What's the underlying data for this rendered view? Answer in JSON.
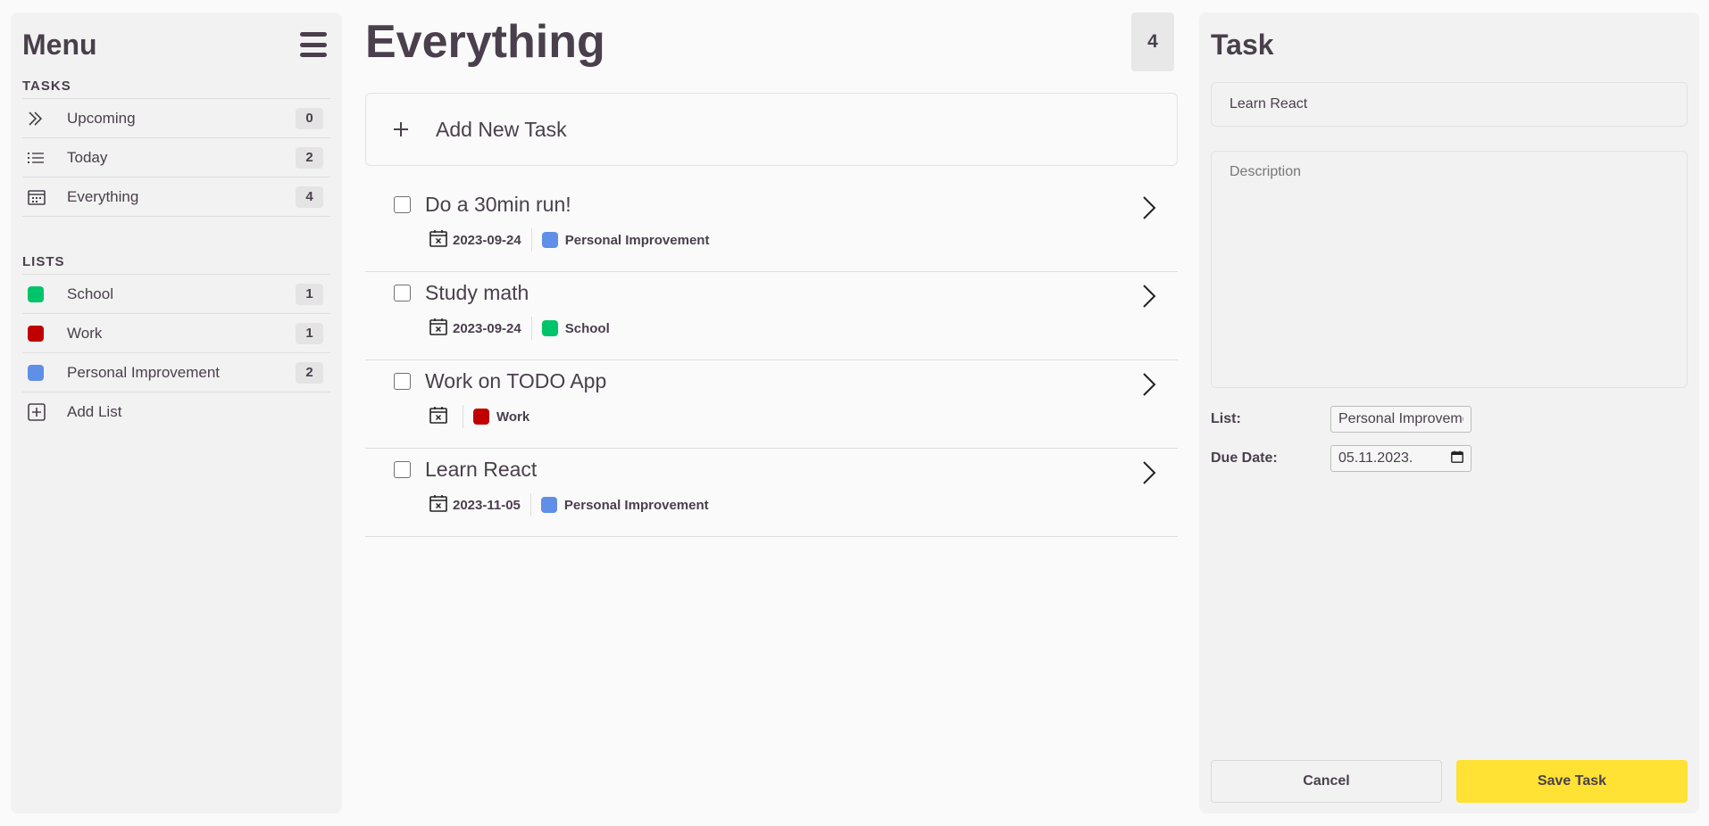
{
  "sidebar": {
    "title": "Menu",
    "tasks_heading": "TASKS",
    "task_items": [
      {
        "label": "Upcoming",
        "count": "0",
        "icon": "double-chevron-right-icon"
      },
      {
        "label": "Today",
        "count": "2",
        "icon": "list-icon"
      },
      {
        "label": "Everything",
        "count": "4",
        "icon": "calendar-grid-icon"
      }
    ],
    "lists_heading": "LISTS",
    "lists": [
      {
        "label": "School",
        "count": "1",
        "color": "#00c46a"
      },
      {
        "label": "Work",
        "count": "1",
        "color": "#c00000"
      },
      {
        "label": "Personal Improvement",
        "count": "2",
        "color": "#5f8fe6"
      }
    ],
    "add_list_label": "Add List"
  },
  "main": {
    "title": "Everything",
    "total_count": "4",
    "add_task_label": "Add New Task",
    "tasks": [
      {
        "title": "Do a 30min run!",
        "date": "2023-09-24",
        "list": "Personal Improvement",
        "list_color": "#5f8fe6"
      },
      {
        "title": "Study math",
        "date": "2023-09-24",
        "list": "School",
        "list_color": "#00c46a"
      },
      {
        "title": "Work on TODO App",
        "date": "",
        "list": "Work",
        "list_color": "#c00000"
      },
      {
        "title": "Learn React",
        "date": "2023-11-05",
        "list": "Personal Improvement",
        "list_color": "#5f8fe6"
      }
    ]
  },
  "detail": {
    "title": "Task",
    "task_name_value": "Learn React",
    "description_placeholder": "Description",
    "list_label": "List:",
    "list_selected": "Personal Improvement",
    "due_date_label": "Due Date:",
    "due_date_value": "05.11.2023.",
    "cancel_label": "Cancel",
    "save_label": "Save Task"
  },
  "colors": {
    "accent_yellow": "#ffe234",
    "text": "#4a3f4c"
  }
}
